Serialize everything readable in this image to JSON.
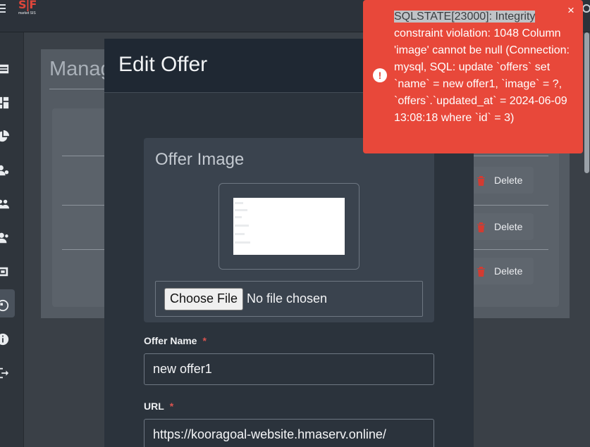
{
  "header": {
    "logo_text": "S|F",
    "logo_sub": "market SIS"
  },
  "sidebar": {
    "items": [
      {
        "icon": "table-icon"
      },
      {
        "icon": "dashboard-icon"
      },
      {
        "icon": "pie-chart-icon"
      },
      {
        "icon": "users-cog-icon"
      },
      {
        "icon": "users-icon"
      },
      {
        "icon": "user-group-icon"
      },
      {
        "icon": "offers-icon",
        "active": true
      },
      {
        "icon": "globe-icon"
      },
      {
        "icon": "info-icon"
      },
      {
        "icon": "sign-out-icon"
      }
    ]
  },
  "background": {
    "page_title": "Manag",
    "rows": [
      {
        "delete_label": "Delete"
      },
      {
        "delete_label": "Delete"
      },
      {
        "delete_label": "Delete"
      }
    ]
  },
  "modal": {
    "title": "Edit Offer",
    "image_section_title": "Offer Image",
    "file_button_label": "Choose File",
    "file_status": "No file chosen",
    "offer_name_label": "Offer Name",
    "offer_name_value": "new offer1",
    "url_label": "URL",
    "url_value": "https://kooragoal-website.hmaserv.online/",
    "required_mark": "*"
  },
  "toast": {
    "highlight": "SQLSTATE[23000]: Integrity",
    "message": "constraint violation: 1048 Column 'image' cannot be null (Connection: mysql, SQL: update `offers` set `name` = new offer1, `image` = ?, `offers`.`updated_at` = 2024-06-09 13:08:18 where `id` = 3)",
    "icon": "!",
    "close": "×",
    "color": "#e8483a"
  }
}
